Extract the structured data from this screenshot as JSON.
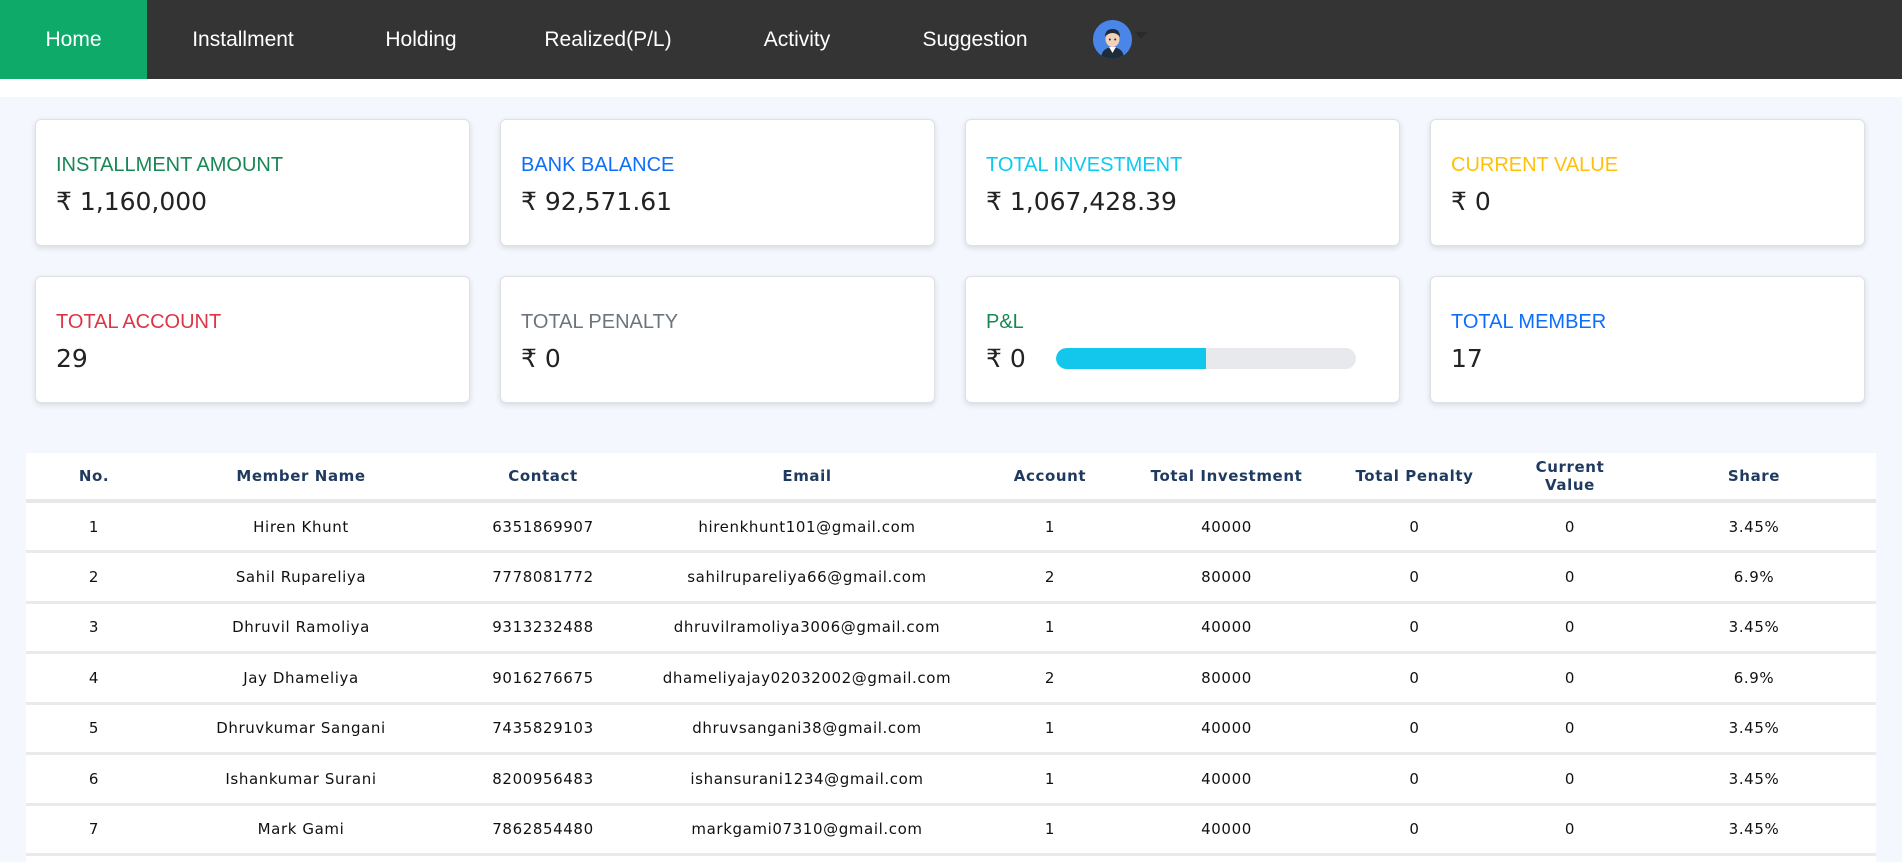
{
  "nav": {
    "items": [
      {
        "label": "Home",
        "active": true
      },
      {
        "label": "Installment",
        "active": false
      },
      {
        "label": "Holding",
        "active": false
      },
      {
        "label": "Realized(P/L)",
        "active": false
      },
      {
        "label": "Activity",
        "active": false
      },
      {
        "label": "Suggestion",
        "active": false
      }
    ],
    "user_icon": "user-avatar-icon",
    "dropdown_icon": "caret-down-icon"
  },
  "cards": {
    "installment_amount": {
      "title": "INSTALLMENT AMOUNT",
      "value": "₹ 1,160,000",
      "color": "#198754"
    },
    "bank_balance": {
      "title": "BANK BALANCE",
      "value": "₹ 92,571.61",
      "color": "#0d6efd"
    },
    "total_investment": {
      "title": "TOTAL INVESTMENT",
      "value": "₹ 1,067,428.39",
      "color": "#0dcaf0"
    },
    "current_value": {
      "title": "CURRENT VALUE",
      "value": "₹ 0",
      "color": "#ffc107"
    },
    "total_account": {
      "title": "TOTAL ACCOUNT",
      "value": "29",
      "color": "#dc3545"
    },
    "total_penalty": {
      "title": "TOTAL PENALTY",
      "value": "₹ 0",
      "color": "#6c757d"
    },
    "pl": {
      "title": "P&L",
      "value": "₹ 0",
      "color": "#198754",
      "progress_fraction": 0.5,
      "progress_color": "#13c7ec"
    },
    "total_member": {
      "title": "TOTAL MEMBER",
      "value": "17",
      "color": "#0d6efd"
    }
  },
  "table": {
    "headers": [
      "No.",
      "Member Name",
      "Contact",
      "Email",
      "Account",
      "Total Investment",
      "Total Penalty",
      "Current Value",
      "Share"
    ],
    "rows": [
      [
        "1",
        "Hiren Khunt",
        "6351869907",
        "hirenkhunt101@gmail.com",
        "1",
        "40000",
        "0",
        "0",
        "3.45%"
      ],
      [
        "2",
        "Sahil Rupareliya",
        "7778081772",
        "sahilrupareliya66@gmail.com",
        "2",
        "80000",
        "0",
        "0",
        "6.9%"
      ],
      [
        "3",
        "Dhruvil Ramoliya",
        "9313232488",
        "dhruvilramoliya3006@gmail.com",
        "1",
        "40000",
        "0",
        "0",
        "3.45%"
      ],
      [
        "4",
        "Jay Dhameliya",
        "9016276675",
        "dhameliyajay02032002@gmail.com",
        "2",
        "80000",
        "0",
        "0",
        "6.9%"
      ],
      [
        "5",
        "Dhruvkumar Sangani",
        "7435829103",
        "dhruvsangani38@gmail.com",
        "1",
        "40000",
        "0",
        "0",
        "3.45%"
      ],
      [
        "6",
        "Ishankumar Surani",
        "8200956483",
        "ishansurani1234@gmail.com",
        "1",
        "40000",
        "0",
        "0",
        "3.45%"
      ],
      [
        "7",
        "Mark Gami",
        "7862854480",
        "markgami07310@gmail.com",
        "1",
        "40000",
        "0",
        "0",
        "3.45%"
      ]
    ]
  }
}
